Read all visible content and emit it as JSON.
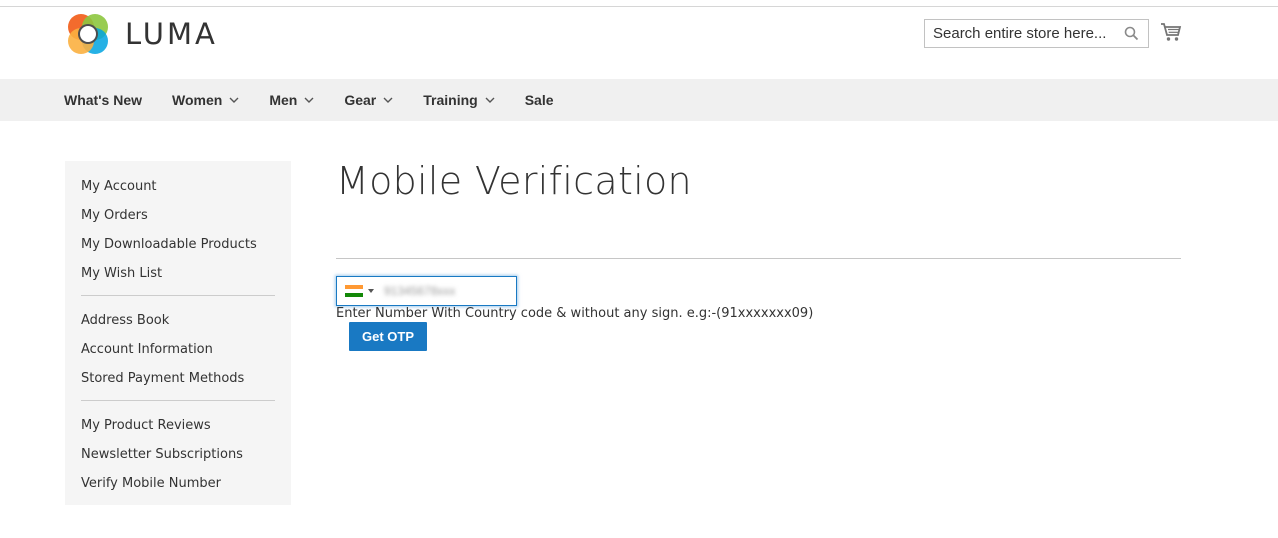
{
  "header": {
    "logo_text": "LUMA",
    "search": {
      "placeholder": "Search entire store here..."
    }
  },
  "nav": {
    "items": [
      {
        "label": "What's New",
        "has_dropdown": false
      },
      {
        "label": "Women",
        "has_dropdown": true
      },
      {
        "label": "Men",
        "has_dropdown": true
      },
      {
        "label": "Gear",
        "has_dropdown": true
      },
      {
        "label": "Training",
        "has_dropdown": true
      },
      {
        "label": "Sale",
        "has_dropdown": false
      }
    ]
  },
  "sidebar": {
    "group1": [
      "My Account",
      "My Orders",
      "My Downloadable Products",
      "My Wish List"
    ],
    "group2": [
      "Address Book",
      "Account Information",
      "Stored Payment Methods"
    ],
    "group3": [
      "My Product Reviews",
      "Newsletter Subscriptions",
      "Verify Mobile Number"
    ]
  },
  "main": {
    "title": "Mobile Verification",
    "phone_value": "91345678xxx",
    "country_flag": "india-flag-icon",
    "hint": "Enter Number With Country code & without any sign. e.g:-(91xxxxxxx09)",
    "otp_button": "Get OTP"
  },
  "colors": {
    "accent": "#1979c3",
    "nav_bg": "#f0f0f0",
    "sidebar_bg": "#f5f5f5"
  }
}
